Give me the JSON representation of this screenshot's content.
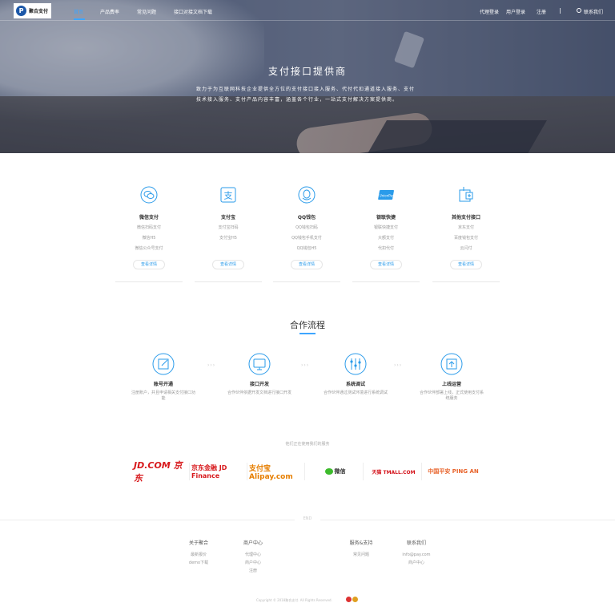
{
  "nav": {
    "logo_text": "聚合支付",
    "items": [
      {
        "label": "首页",
        "active": true
      },
      {
        "label": "产品费率",
        "active": false
      },
      {
        "label": "常见问题",
        "active": false
      },
      {
        "label": "接口对接文档下载",
        "active": false
      }
    ],
    "right": {
      "agent_login": "代理登录",
      "user_login": "用户登录",
      "register": "注册",
      "contact": "联系我们"
    }
  },
  "hero": {
    "title": "支付接口提供商",
    "desc_line1": "致力于为互联网科技企业提供全方位的支付接口接入服务、代付代扣通道接入服务、支付",
    "desc_line2": "技术接入服务、支付产品内容丰富，涵盖各个行业，一站式支付解决方案提供商。"
  },
  "services": [
    {
      "name": "微信支付",
      "features": [
        "微信扫码支付",
        "微信H5",
        "微信公众号支付"
      ],
      "button": "查看详情",
      "icon": "wechat-icon"
    },
    {
      "name": "支付宝",
      "features": [
        "支付宝扫码",
        "支付宝H5"
      ],
      "button": "查看详情",
      "icon": "alipay-icon"
    },
    {
      "name": "QQ钱包",
      "features": [
        "QQ钱包扫码",
        "QQ钱包手机支付",
        "QQ钱包H5"
      ],
      "button": "查看详情",
      "icon": "qq-icon"
    },
    {
      "name": "银联快捷",
      "features": [
        "银联快捷支付",
        "大额支付",
        "代扣代付"
      ],
      "button": "查看详情",
      "icon": "unionpay-icon"
    },
    {
      "name": "其他支付接口",
      "features": [
        "京东支付",
        "百度钱包支付",
        "云闪付"
      ],
      "button": "查看详情",
      "icon": "other-payment-icon"
    }
  ],
  "process": {
    "title": "合作流程",
    "steps": [
      {
        "label": "账号开通",
        "desc": "注册账户，并且申请相关支付接口功能"
      },
      {
        "label": "接口开发",
        "desc": "合作伙伴依据开发文档进行接口开发"
      },
      {
        "label": "系统调试",
        "desc": "合作伙伴通过测试环境进行系统调试"
      },
      {
        "label": "上线运营",
        "desc": "合作伙伴部署上线，正式使用支付系统服务"
      }
    ],
    "arrow": "›››"
  },
  "partners": {
    "caption": "他们正在使用我们的服务",
    "items": [
      "JD.COM 京东",
      "京东金融 JD Finance",
      "支付宝 Alipay.com",
      "微信",
      "天猫 TMALL.COM",
      "中国平安 PING AN"
    ]
  },
  "end_text": "END",
  "footer": {
    "columns": [
      {
        "heading": "关于聚合",
        "links": [
          "最新报价",
          "demo下载"
        ]
      },
      {
        "heading": "商户中心",
        "links": [
          "代理中心",
          "商户中心",
          "注册"
        ]
      },
      {
        "heading": "服务&支持",
        "links": [
          "常见问题"
        ]
      },
      {
        "heading": "联系我们",
        "links": [
          "info@pay.com",
          "商户中心"
        ]
      }
    ],
    "copyright": "Copyright © 2018聚合支付. All Rights Reserved."
  },
  "colors": {
    "accent": "#3ea6ff",
    "link": "#2a9bea"
  }
}
